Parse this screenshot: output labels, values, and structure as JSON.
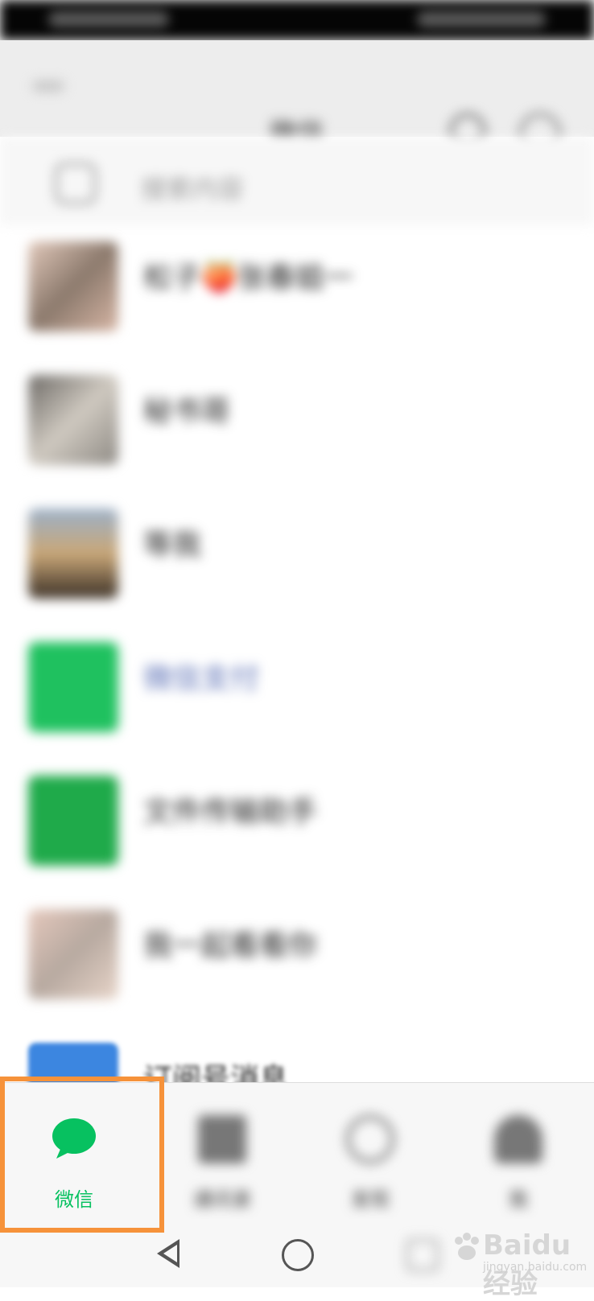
{
  "header": {
    "title": "微信"
  },
  "search": {
    "placeholder": "搜索内容"
  },
  "chats": [
    {
      "name": "松子🍑张春姐一",
      "preview": "",
      "time": "",
      "avatar_color": "#b9a89a"
    },
    {
      "name": "秘书哥",
      "preview": "",
      "time": "",
      "avatar_color": "#a8a39c"
    },
    {
      "name": "等我",
      "preview": "",
      "time": "",
      "avatar_color": "#6d5c45"
    },
    {
      "name": "微信支付",
      "preview": "",
      "time": "",
      "avatar_color": "#1fc15f"
    },
    {
      "name": "文件传输助手",
      "preview": "",
      "time": "",
      "avatar_color": "#1faa4a"
    },
    {
      "name": "我一起看看你",
      "preview": "",
      "time": "",
      "avatar_color": "#c7b2a3"
    },
    {
      "name": "订阅号消息",
      "preview": "",
      "time": "",
      "avatar_color": "#3c86e0"
    }
  ],
  "tabs": [
    {
      "label": "微信",
      "icon": "chat-bubble-icon",
      "active": true,
      "color": "#07c160"
    },
    {
      "label": "通讯录",
      "icon": "contacts-icon",
      "active": false
    },
    {
      "label": "发现",
      "icon": "compass-icon",
      "active": false
    },
    {
      "label": "我",
      "icon": "person-icon",
      "active": false
    }
  ],
  "watermark": {
    "text": "Baidu经验",
    "sub": "jingyan.baidu.com"
  },
  "colors": {
    "highlight": "#f6923a",
    "accent": "#07c160"
  }
}
